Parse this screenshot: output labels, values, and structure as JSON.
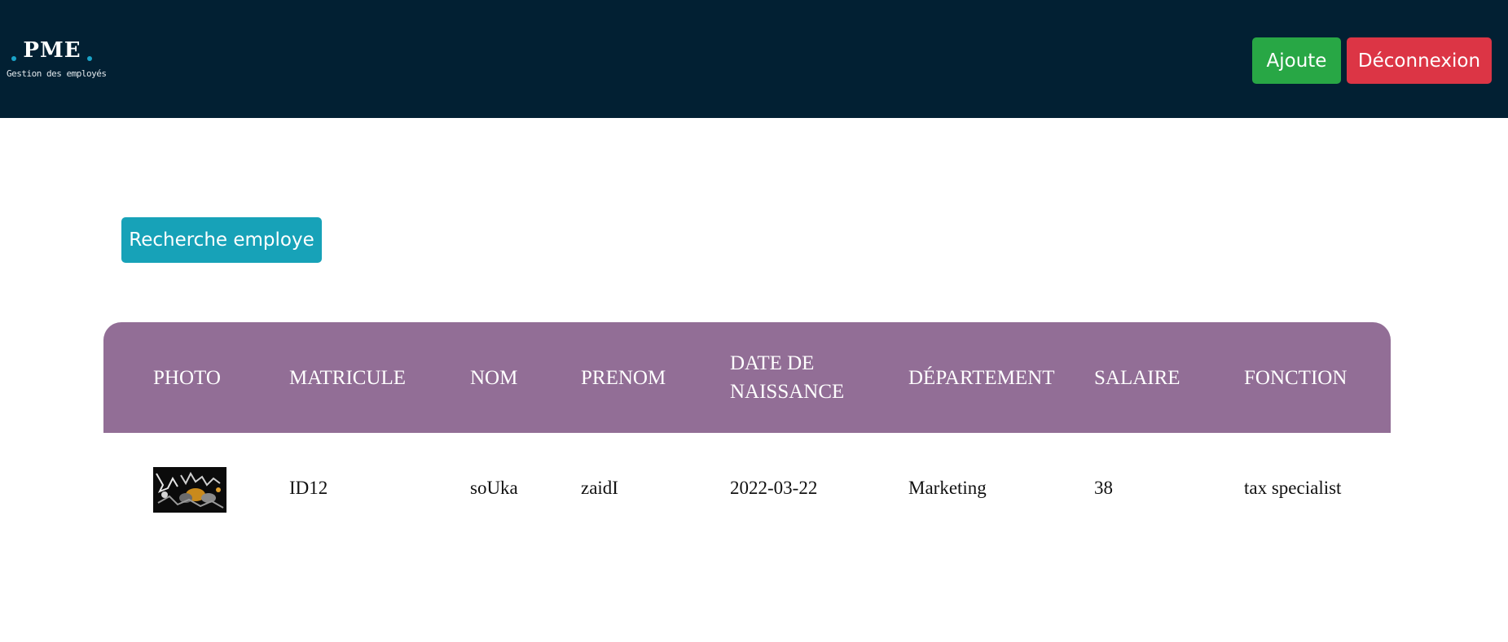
{
  "navbar": {
    "logo_title": "PME",
    "logo_subtitle": "Gestion des employés",
    "add_label": "Ajoute",
    "logout_label": "Déconnexion"
  },
  "search": {
    "button_label": "Recherche employe"
  },
  "table": {
    "headers": [
      "PHOTO",
      "MATRICULE",
      "NOM",
      "PRENOM",
      "DATE DE NAISSANCE",
      "DÉPARTEMENT",
      "SALAIRE",
      "FONCTION"
    ],
    "rows": [
      {
        "matricule": "ID12",
        "nom": "soUka",
        "prenom": "zaidI",
        "date_naissance": "2022-03-22",
        "departement": "Marketing",
        "salaire": "38",
        "fonction": "tax specialist"
      }
    ]
  },
  "colors": {
    "navbar_bg": "#022033",
    "add_button": "#28a745",
    "logout_button": "#dc3545",
    "search_button": "#17a2b8",
    "table_header": "#926e96"
  }
}
